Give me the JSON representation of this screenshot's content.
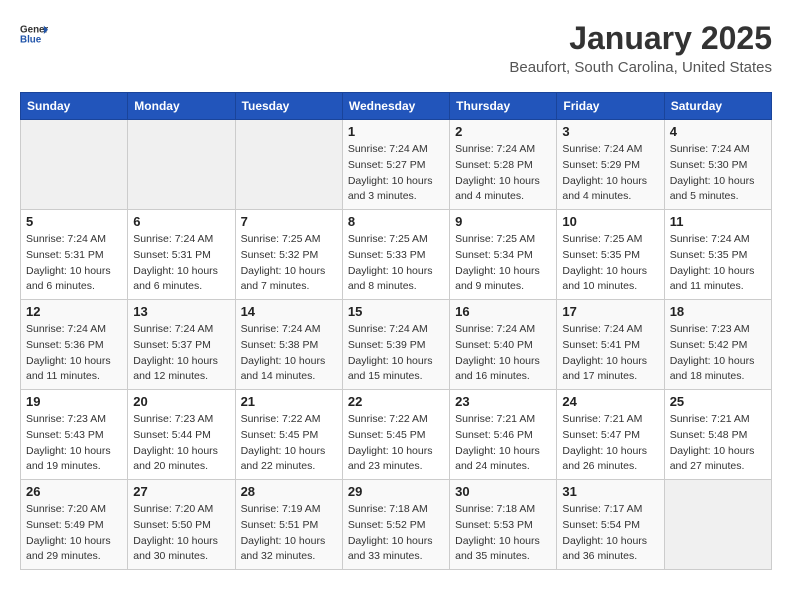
{
  "header": {
    "logo_general": "General",
    "logo_blue": "Blue",
    "title": "January 2025",
    "subtitle": "Beaufort, South Carolina, United States"
  },
  "weekdays": [
    "Sunday",
    "Monday",
    "Tuesday",
    "Wednesday",
    "Thursday",
    "Friday",
    "Saturday"
  ],
  "weeks": [
    [
      {
        "day": "",
        "sunrise": "",
        "sunset": "",
        "daylight": ""
      },
      {
        "day": "",
        "sunrise": "",
        "sunset": "",
        "daylight": ""
      },
      {
        "day": "",
        "sunrise": "",
        "sunset": "",
        "daylight": ""
      },
      {
        "day": "1",
        "sunrise": "Sunrise: 7:24 AM",
        "sunset": "Sunset: 5:27 PM",
        "daylight": "Daylight: 10 hours and 3 minutes."
      },
      {
        "day": "2",
        "sunrise": "Sunrise: 7:24 AM",
        "sunset": "Sunset: 5:28 PM",
        "daylight": "Daylight: 10 hours and 4 minutes."
      },
      {
        "day": "3",
        "sunrise": "Sunrise: 7:24 AM",
        "sunset": "Sunset: 5:29 PM",
        "daylight": "Daylight: 10 hours and 4 minutes."
      },
      {
        "day": "4",
        "sunrise": "Sunrise: 7:24 AM",
        "sunset": "Sunset: 5:30 PM",
        "daylight": "Daylight: 10 hours and 5 minutes."
      }
    ],
    [
      {
        "day": "5",
        "sunrise": "Sunrise: 7:24 AM",
        "sunset": "Sunset: 5:31 PM",
        "daylight": "Daylight: 10 hours and 6 minutes."
      },
      {
        "day": "6",
        "sunrise": "Sunrise: 7:24 AM",
        "sunset": "Sunset: 5:31 PM",
        "daylight": "Daylight: 10 hours and 6 minutes."
      },
      {
        "day": "7",
        "sunrise": "Sunrise: 7:25 AM",
        "sunset": "Sunset: 5:32 PM",
        "daylight": "Daylight: 10 hours and 7 minutes."
      },
      {
        "day": "8",
        "sunrise": "Sunrise: 7:25 AM",
        "sunset": "Sunset: 5:33 PM",
        "daylight": "Daylight: 10 hours and 8 minutes."
      },
      {
        "day": "9",
        "sunrise": "Sunrise: 7:25 AM",
        "sunset": "Sunset: 5:34 PM",
        "daylight": "Daylight: 10 hours and 9 minutes."
      },
      {
        "day": "10",
        "sunrise": "Sunrise: 7:25 AM",
        "sunset": "Sunset: 5:35 PM",
        "daylight": "Daylight: 10 hours and 10 minutes."
      },
      {
        "day": "11",
        "sunrise": "Sunrise: 7:24 AM",
        "sunset": "Sunset: 5:35 PM",
        "daylight": "Daylight: 10 hours and 11 minutes."
      }
    ],
    [
      {
        "day": "12",
        "sunrise": "Sunrise: 7:24 AM",
        "sunset": "Sunset: 5:36 PM",
        "daylight": "Daylight: 10 hours and 11 minutes."
      },
      {
        "day": "13",
        "sunrise": "Sunrise: 7:24 AM",
        "sunset": "Sunset: 5:37 PM",
        "daylight": "Daylight: 10 hours and 12 minutes."
      },
      {
        "day": "14",
        "sunrise": "Sunrise: 7:24 AM",
        "sunset": "Sunset: 5:38 PM",
        "daylight": "Daylight: 10 hours and 14 minutes."
      },
      {
        "day": "15",
        "sunrise": "Sunrise: 7:24 AM",
        "sunset": "Sunset: 5:39 PM",
        "daylight": "Daylight: 10 hours and 15 minutes."
      },
      {
        "day": "16",
        "sunrise": "Sunrise: 7:24 AM",
        "sunset": "Sunset: 5:40 PM",
        "daylight": "Daylight: 10 hours and 16 minutes."
      },
      {
        "day": "17",
        "sunrise": "Sunrise: 7:24 AM",
        "sunset": "Sunset: 5:41 PM",
        "daylight": "Daylight: 10 hours and 17 minutes."
      },
      {
        "day": "18",
        "sunrise": "Sunrise: 7:23 AM",
        "sunset": "Sunset: 5:42 PM",
        "daylight": "Daylight: 10 hours and 18 minutes."
      }
    ],
    [
      {
        "day": "19",
        "sunrise": "Sunrise: 7:23 AM",
        "sunset": "Sunset: 5:43 PM",
        "daylight": "Daylight: 10 hours and 19 minutes."
      },
      {
        "day": "20",
        "sunrise": "Sunrise: 7:23 AM",
        "sunset": "Sunset: 5:44 PM",
        "daylight": "Daylight: 10 hours and 20 minutes."
      },
      {
        "day": "21",
        "sunrise": "Sunrise: 7:22 AM",
        "sunset": "Sunset: 5:45 PM",
        "daylight": "Daylight: 10 hours and 22 minutes."
      },
      {
        "day": "22",
        "sunrise": "Sunrise: 7:22 AM",
        "sunset": "Sunset: 5:45 PM",
        "daylight": "Daylight: 10 hours and 23 minutes."
      },
      {
        "day": "23",
        "sunrise": "Sunrise: 7:21 AM",
        "sunset": "Sunset: 5:46 PM",
        "daylight": "Daylight: 10 hours and 24 minutes."
      },
      {
        "day": "24",
        "sunrise": "Sunrise: 7:21 AM",
        "sunset": "Sunset: 5:47 PM",
        "daylight": "Daylight: 10 hours and 26 minutes."
      },
      {
        "day": "25",
        "sunrise": "Sunrise: 7:21 AM",
        "sunset": "Sunset: 5:48 PM",
        "daylight": "Daylight: 10 hours and 27 minutes."
      }
    ],
    [
      {
        "day": "26",
        "sunrise": "Sunrise: 7:20 AM",
        "sunset": "Sunset: 5:49 PM",
        "daylight": "Daylight: 10 hours and 29 minutes."
      },
      {
        "day": "27",
        "sunrise": "Sunrise: 7:20 AM",
        "sunset": "Sunset: 5:50 PM",
        "daylight": "Daylight: 10 hours and 30 minutes."
      },
      {
        "day": "28",
        "sunrise": "Sunrise: 7:19 AM",
        "sunset": "Sunset: 5:51 PM",
        "daylight": "Daylight: 10 hours and 32 minutes."
      },
      {
        "day": "29",
        "sunrise": "Sunrise: 7:18 AM",
        "sunset": "Sunset: 5:52 PM",
        "daylight": "Daylight: 10 hours and 33 minutes."
      },
      {
        "day": "30",
        "sunrise": "Sunrise: 7:18 AM",
        "sunset": "Sunset: 5:53 PM",
        "daylight": "Daylight: 10 hours and 35 minutes."
      },
      {
        "day": "31",
        "sunrise": "Sunrise: 7:17 AM",
        "sunset": "Sunset: 5:54 PM",
        "daylight": "Daylight: 10 hours and 36 minutes."
      },
      {
        "day": "",
        "sunrise": "",
        "sunset": "",
        "daylight": ""
      }
    ]
  ]
}
